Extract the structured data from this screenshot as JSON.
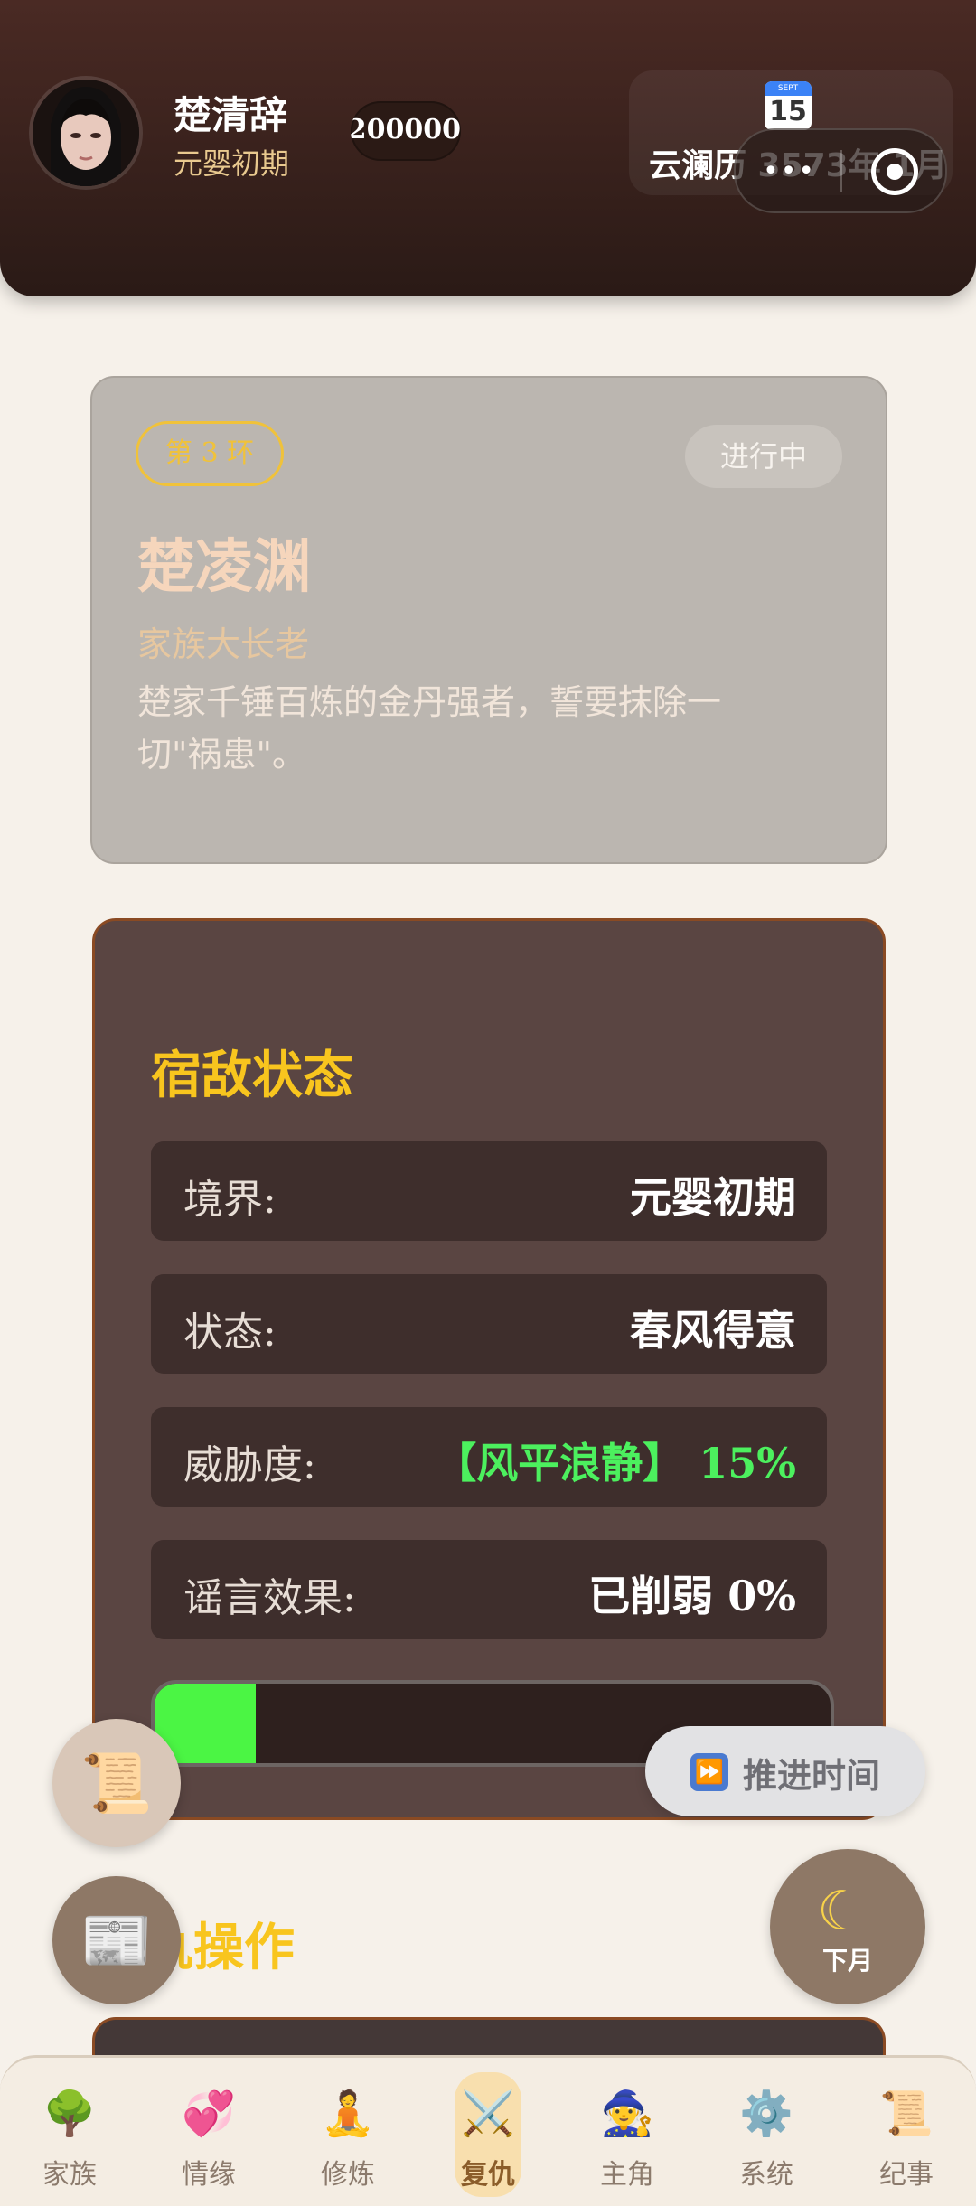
{
  "header": {
    "user_name": "楚清辞",
    "user_realm": "元婴初期",
    "exp_text": "/200000",
    "calendar": {
      "icon_month": "SEPT",
      "icon_day": "15",
      "text": "云澜历 3573年 1月"
    }
  },
  "enemy": {
    "ring": "第 3 环",
    "status": "进行中",
    "name": "楚凌渊",
    "title": "家族大长老",
    "description": "楚家千锤百炼的金丹强者，誓要抹除一切\"祸患\"。"
  },
  "status_panel": {
    "title": "宿敌状态",
    "rows": [
      {
        "label": "境界:",
        "value": "元婴初期"
      },
      {
        "label": "状态:",
        "value": "春风得意"
      },
      {
        "label": "威胁度:",
        "value": "【风平浪静】 15%"
      },
      {
        "label": "谣言效果:",
        "value": "已削弱 0%"
      }
    ],
    "threat_level_percent": 15,
    "threat_color": "#4bf544"
  },
  "floating": {
    "advance_label": "推进时间",
    "month_label": "下月"
  },
  "section": {
    "title": "复仇操作"
  },
  "tabs": [
    {
      "label": "家族",
      "icon": "tree-icon"
    },
    {
      "label": "情缘",
      "icon": "heart-icon"
    },
    {
      "label": "修炼",
      "icon": "meditation-icon"
    },
    {
      "label": "复仇",
      "icon": "crossed-swords-icon"
    },
    {
      "label": "主角",
      "icon": "witch-icon"
    },
    {
      "label": "系统",
      "icon": "gear-icon"
    },
    {
      "label": "纪事",
      "icon": "scroll-icon"
    }
  ],
  "active_tab": "复仇"
}
